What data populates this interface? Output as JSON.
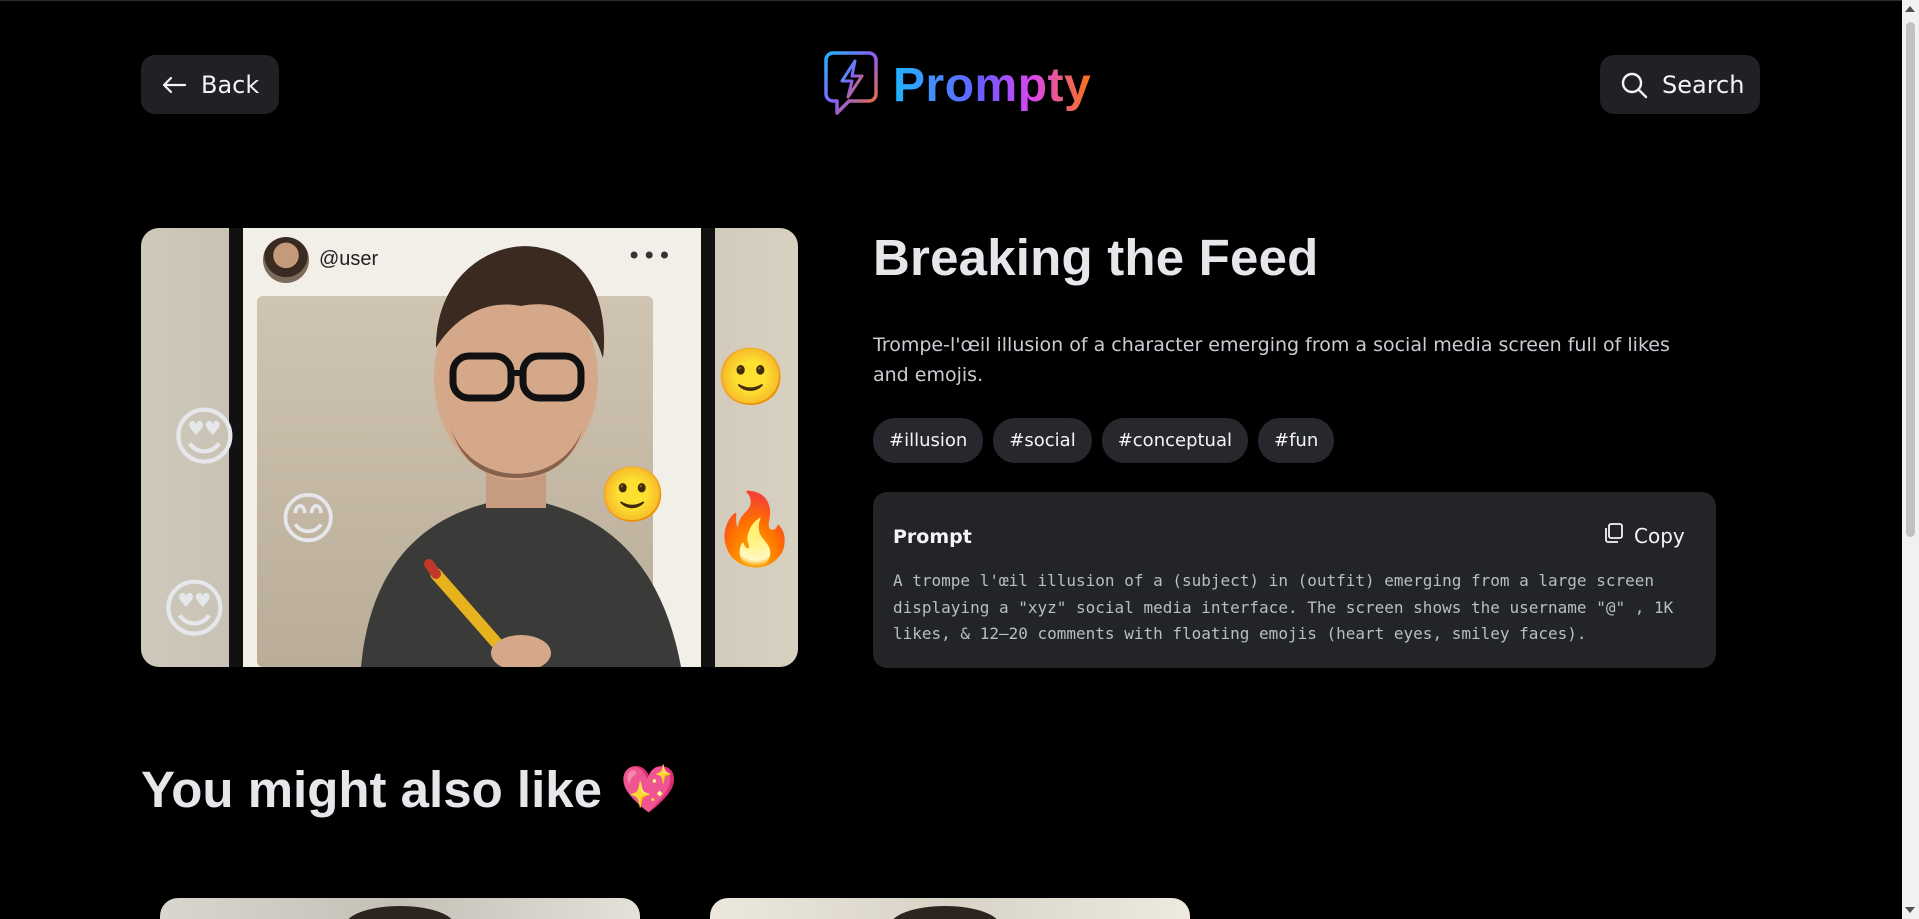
{
  "header": {
    "back_label": "Back",
    "search_label": "Search",
    "logo_text": "Prompty"
  },
  "hero": {
    "image_username": "@user",
    "image_menu": "•••"
  },
  "detail": {
    "title": "Breaking the Feed",
    "description": "Trompe-l'œil illusion of a character emerging from a social media screen full of likes and emojis.",
    "tags": [
      "#illusion",
      "#social",
      "#conceptual",
      "#fun"
    ]
  },
  "prompt": {
    "label": "Prompt",
    "copy_label": "Copy",
    "text": "A trompe l'œil illusion of a (subject) in (outfit) emerging from a large screen\ndisplaying a \"xyz\" social media interface. The screen shows the username \"@\" , 1K\nlikes, & 12–20 comments with floating emojis (heart eyes, smiley faces)."
  },
  "related": {
    "title": "You might also like",
    "emoji": "💖"
  },
  "colors": {
    "background": "#000000",
    "surface": "#222428",
    "pill": "#1f2125",
    "text_primary": "#e5e7eb",
    "text_muted": "#c9ccd2",
    "logo_gradient": [
      "#1fb6ff",
      "#6a5cff",
      "#d946ef",
      "#f97316"
    ]
  }
}
